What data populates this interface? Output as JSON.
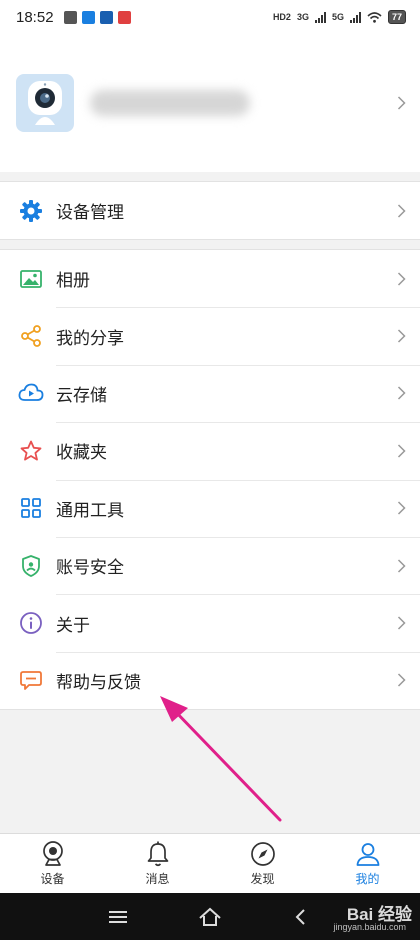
{
  "status_bar": {
    "time": "18:52",
    "network_1": "HD2",
    "network_2": "3G",
    "network_3": "5G",
    "battery": "77"
  },
  "profile": {
    "avatar_icon": "camera-avatar-icon"
  },
  "device_section": {
    "items": [
      {
        "label": "设备管理",
        "icon": "gear-icon",
        "color": "#1a7fe0"
      }
    ]
  },
  "menu": {
    "items": [
      {
        "label": "相册",
        "icon": "image-icon",
        "color": "#36b26b"
      },
      {
        "label": "我的分享",
        "icon": "share-icon",
        "color": "#f0a020"
      },
      {
        "label": "云存储",
        "icon": "cloud-icon",
        "color": "#1a7fe0"
      },
      {
        "label": "收藏夹",
        "icon": "star-icon",
        "color": "#e85050"
      },
      {
        "label": "通用工具",
        "icon": "grid-icon",
        "color": "#1a7fe0"
      },
      {
        "label": "账号安全",
        "icon": "shield-icon",
        "color": "#36b26b"
      },
      {
        "label": "关于",
        "icon": "info-icon",
        "color": "#7a60c0"
      },
      {
        "label": "帮助与反馈",
        "icon": "feedback-icon",
        "color": "#f07838"
      }
    ]
  },
  "tabs": [
    {
      "label": "设备",
      "icon": "camera-icon",
      "active": false
    },
    {
      "label": "消息",
      "icon": "bell-icon",
      "active": false
    },
    {
      "label": "发现",
      "icon": "compass-icon",
      "active": false
    },
    {
      "label": "我的",
      "icon": "user-icon",
      "active": true
    }
  ],
  "watermark": {
    "brand": "Bai 经验",
    "url": "jingyan.baidu.com"
  },
  "colors": {
    "accent": "#1a7fe0",
    "arrow": "#e0208a"
  }
}
